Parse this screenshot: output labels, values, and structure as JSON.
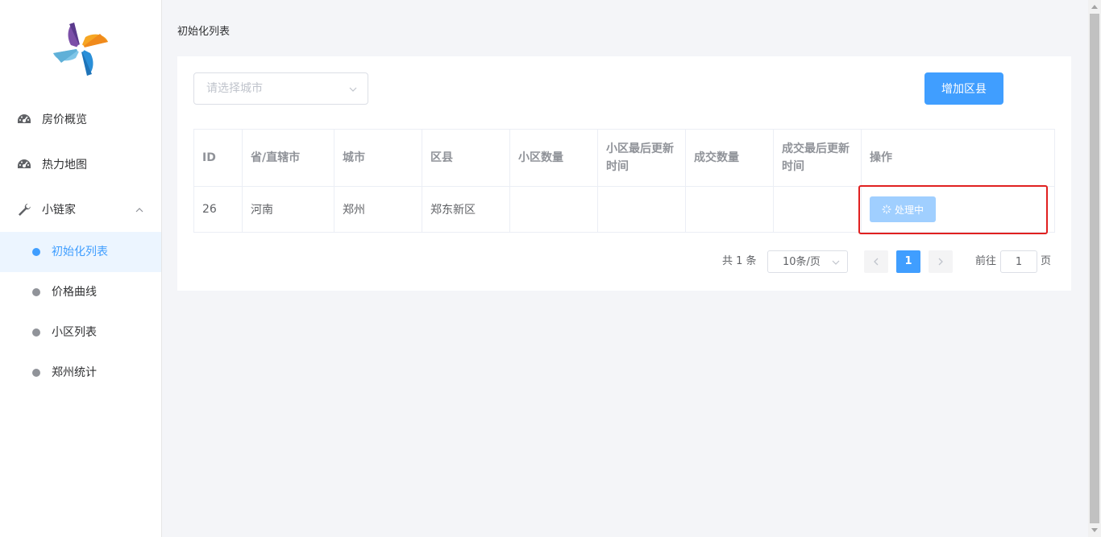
{
  "sidebar": {
    "items": [
      {
        "label": "房价概览",
        "icon": "dashboard-icon"
      },
      {
        "label": "热力地图",
        "icon": "dashboard-icon"
      },
      {
        "label": "小链家",
        "icon": "wrench-icon"
      }
    ],
    "sub_items": [
      {
        "label": "初始化列表",
        "active": true
      },
      {
        "label": "价格曲线",
        "active": false
      },
      {
        "label": "小区列表",
        "active": false
      },
      {
        "label": "郑州统计",
        "active": false
      }
    ]
  },
  "page": {
    "title": "初始化列表"
  },
  "toolbar": {
    "city_select_placeholder": "请选择城市",
    "add_button_label": "增加区县"
  },
  "table": {
    "headers": [
      "ID",
      "省/直辖市",
      "城市",
      "区县",
      "小区数量",
      "小区最后更新时间",
      "成交数量",
      "成交最后更新时间",
      "操作"
    ],
    "rows": [
      {
        "id": "26",
        "province": "河南",
        "city": "郑州",
        "district": "郑东新区",
        "community_count": "",
        "community_updated": "",
        "deal_count": "",
        "deal_updated": "",
        "action_label": "处理中"
      }
    ]
  },
  "pagination": {
    "total_text": "共 1 条",
    "page_size": "10条/页",
    "current_page": "1",
    "goto_prefix": "前往",
    "goto_value": "1",
    "goto_suffix": "页"
  },
  "colors": {
    "primary": "#409eff",
    "processing": "#a0cfff",
    "highlight": "#e02020"
  }
}
